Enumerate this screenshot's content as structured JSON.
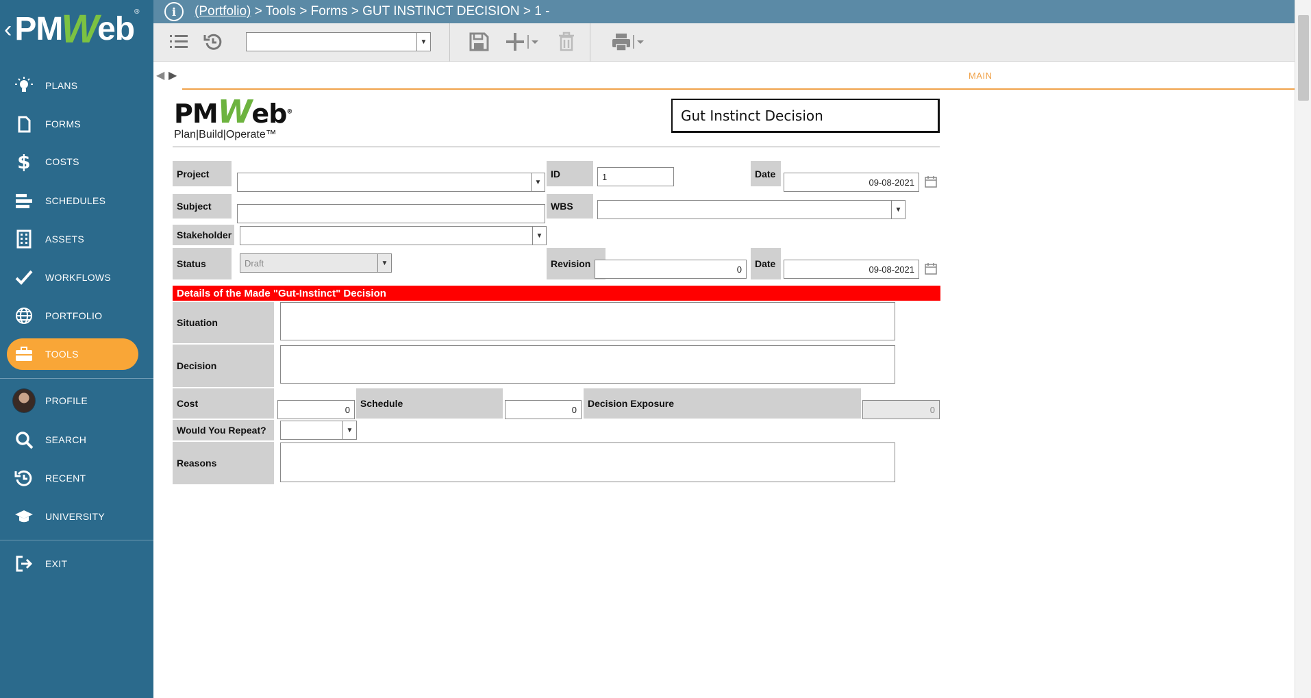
{
  "app": {
    "logo_text": "PMWeb"
  },
  "sidebar": {
    "items": [
      {
        "label": "PLANS",
        "icon": "lightbulb-icon"
      },
      {
        "label": "FORMS",
        "icon": "document-icon"
      },
      {
        "label": "COSTS",
        "icon": "dollar-icon"
      },
      {
        "label": "SCHEDULES",
        "icon": "gantt-icon"
      },
      {
        "label": "ASSETS",
        "icon": "building-icon"
      },
      {
        "label": "WORKFLOWS",
        "icon": "checkmark-icon"
      },
      {
        "label": "PORTFOLIO",
        "icon": "globe-icon"
      },
      {
        "label": "TOOLS",
        "icon": "briefcase-icon",
        "active": true
      },
      {
        "label": "PROFILE",
        "icon": "avatar"
      },
      {
        "label": "SEARCH",
        "icon": "search-icon"
      },
      {
        "label": "RECENT",
        "icon": "history-icon"
      },
      {
        "label": "UNIVERSITY",
        "icon": "graduation-cap-icon"
      },
      {
        "label": "EXIT",
        "icon": "exit-icon"
      }
    ]
  },
  "breadcrumb": {
    "portfolio": "(Portfolio)",
    "rest": " > Tools > Forms > GUT INSTINCT DECISION > 1 -"
  },
  "tabs": {
    "main": "MAIN"
  },
  "form": {
    "logo_tagline": "Plan|Build|Operate™",
    "title": "Gut Instinct Decision",
    "labels": {
      "project": "Project",
      "id": "ID",
      "date1": "Date",
      "subject": "Subject",
      "wbs": "WBS",
      "stakeholder": "Stakeholder",
      "status": "Status",
      "revision": "Revision",
      "date2": "Date",
      "situation": "Situation",
      "decision": "Decision",
      "cost": "Cost",
      "schedule": "Schedule",
      "decision_exposure": "Decision Exposure",
      "repeat": "Would You Repeat?",
      "reasons": "Reasons"
    },
    "values": {
      "project": "",
      "id": "1",
      "date1": "09-08-2021",
      "subject": "",
      "wbs": "",
      "stakeholder": "",
      "status": "Draft",
      "revision": "0",
      "date2": "09-08-2021",
      "situation": "",
      "decision": "",
      "cost": "0",
      "schedule": "0",
      "decision_exposure": "0",
      "repeat": "",
      "reasons": ""
    },
    "section_header": "Details of the Made \"Gut-Instinct\" Decision"
  },
  "colors": {
    "sidebar": "#2b6a8c",
    "accent": "#f9a637",
    "banner": "#ff0000",
    "topbar": "#5b8aa6"
  }
}
